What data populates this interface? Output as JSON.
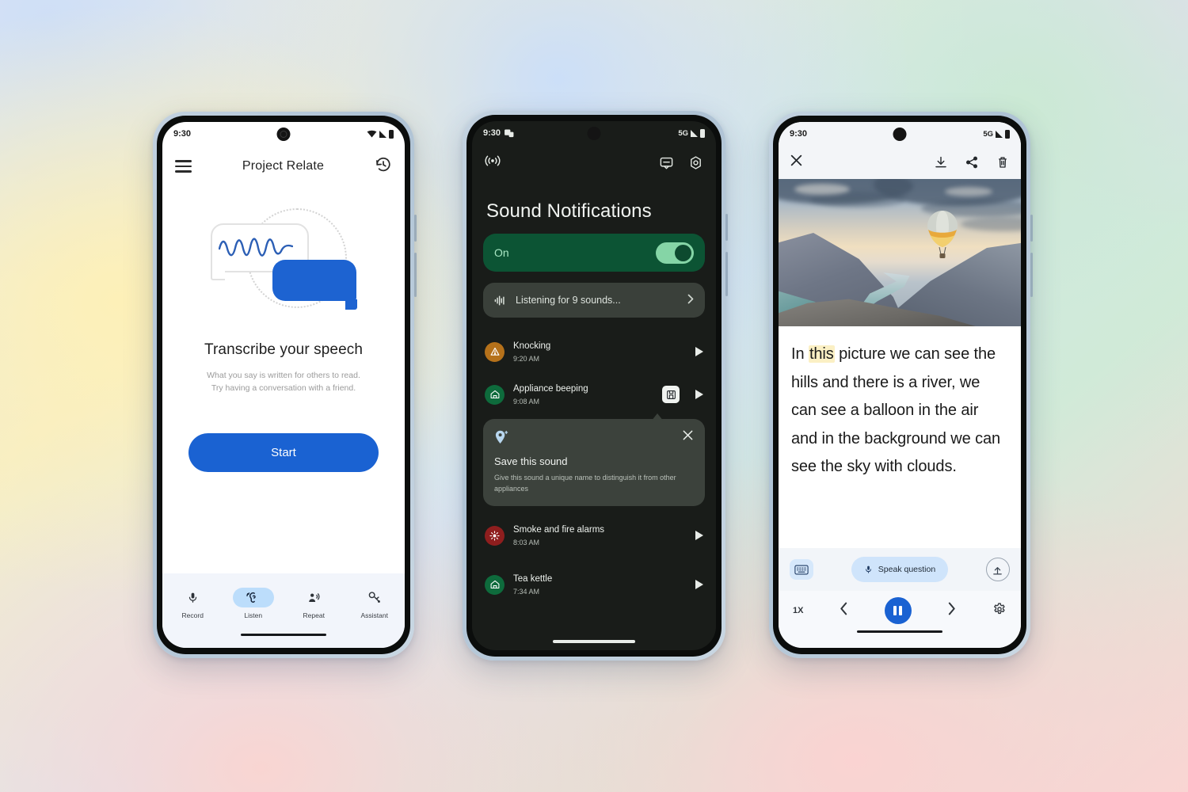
{
  "phone1": {
    "status": {
      "time": "9:30",
      "icons": [
        "wifi-icon",
        "signal-icon",
        "battery-icon"
      ]
    },
    "appbar": {
      "menu_icon": "hamburger-menu-icon",
      "title": "Project Relate",
      "history_icon": "history-icon"
    },
    "hero": {
      "illustration": "speech-bubbles-waveform-illustration",
      "heading": "Transcribe your speech",
      "subtitle_line1": "What you say is written for others to read.",
      "subtitle_line2": "Try having a conversation with a friend."
    },
    "start_label": "Start",
    "nav": [
      {
        "label": "Record",
        "icon": "microphone-icon",
        "active": false
      },
      {
        "label": "Listen",
        "icon": "ear-listen-icon",
        "active": true
      },
      {
        "label": "Repeat",
        "icon": "person-speaking-icon",
        "active": false
      },
      {
        "label": "Assistant",
        "icon": "assistant-icon",
        "active": false
      }
    ],
    "accent": "#1a62d2",
    "nav_active_bg": "#bcddfb"
  },
  "phone2": {
    "status": {
      "time": "9:30",
      "network": "5G",
      "notif_icon": "app-badge-icon"
    },
    "appbar": {
      "left_icon": "sound-waves-icon",
      "icons": [
        "feedback-icon",
        "settings-gear-icon"
      ]
    },
    "title": "Sound Notifications",
    "toggle": {
      "label": "On",
      "state": "on",
      "track_color": "#85d5a6",
      "card_color": "#0c5434"
    },
    "listening": {
      "icon": "audio-bars-icon",
      "label": "Listening for 9 sounds...",
      "chevron": "chevron-right-icon"
    },
    "sounds": [
      {
        "name": "Knocking",
        "time": "9:20 AM",
        "icon": "knocking-warning-icon",
        "icon_color": "#b5711a",
        "play": "play-icon",
        "has_save": false
      },
      {
        "name": "Appliance beeping",
        "time": "9:08 AM",
        "icon": "appliance-home-icon",
        "icon_color": "#0e6b3c",
        "play": "play-icon",
        "has_save": true,
        "save_icon": "save-sound-icon"
      },
      {
        "name": "Smoke and fire alarms",
        "time": "8:03 AM",
        "icon": "smoke-alarm-icon",
        "icon_color": "#8f1e1e",
        "play": "play-icon",
        "has_save": false
      },
      {
        "name": "Tea kettle",
        "time": "7:34 AM",
        "icon": "appliance-home-icon",
        "icon_color": "#0e6b3c",
        "play": "play-icon",
        "has_save": false
      }
    ],
    "tooltip": {
      "icon": "save-pin-icon",
      "close_icon": "close-x-icon",
      "title": "Save this sound",
      "body": "Give this sound a unique name to distinguish it from other appliances"
    },
    "bg": "#191c19"
  },
  "phone3": {
    "status": {
      "time": "9:30",
      "network": "5G"
    },
    "appbar": {
      "close_icon": "close-x-icon",
      "icons": [
        "download-icon",
        "share-icon",
        "delete-trash-icon"
      ]
    },
    "photo": {
      "alt": "hot-air-balloon-over-canyon-river-photo"
    },
    "transcript": {
      "before": "In ",
      "highlight": "this",
      "after": " picture we can see the hills and there is a river, we can see a balloon in the air and in the background we can see the sky with clouds.",
      "highlight_color": "#fbf0c4"
    },
    "actions": {
      "keyboard_icon": "keyboard-icon",
      "speak_label": "Speak question",
      "speak_icon": "microphone-icon",
      "upload_icon": "upload-icon"
    },
    "controls": {
      "speed": "1X",
      "prev_icon": "chevron-left-icon",
      "pause_icon": "pause-icon",
      "next_icon": "chevron-right-icon",
      "settings_icon": "settings-gear-icon"
    },
    "accent": "#1a62d2"
  }
}
